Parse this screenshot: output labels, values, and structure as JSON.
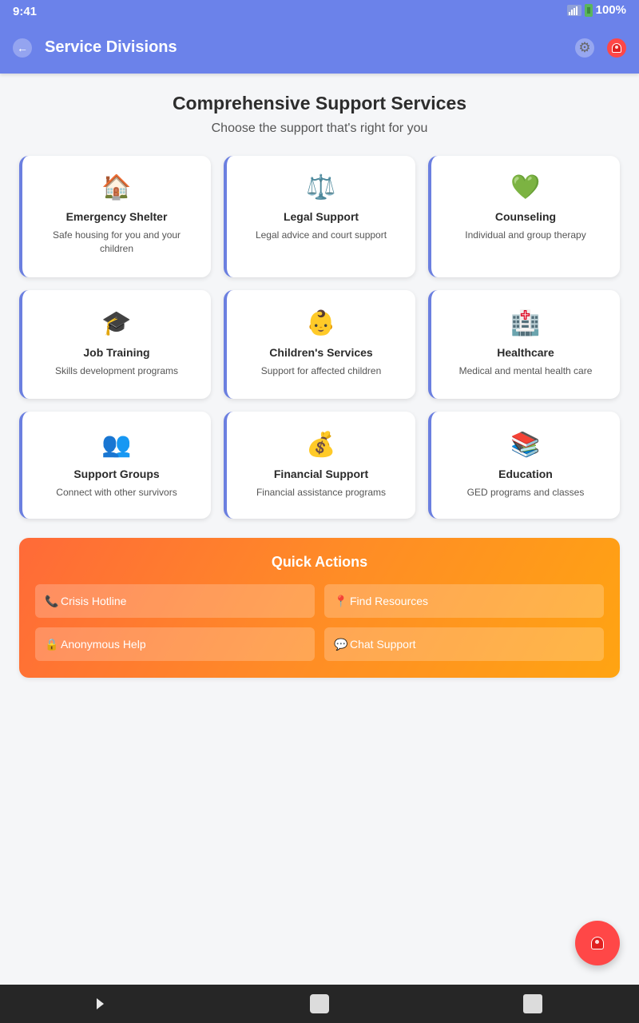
{
  "status_bar": {
    "time": "9:41",
    "battery": "100%"
  },
  "app_bar": {
    "title": "Service Divisions"
  },
  "intro": {
    "title": "Comprehensive Support Services",
    "subtitle": "Choose the support that's right for you"
  },
  "services": [
    {
      "emoji": "🏠",
      "icon": "house-icon",
      "title": "Emergency Shelter",
      "desc": "Safe housing for you and your children"
    },
    {
      "emoji": "⚖️",
      "icon": "scales-icon",
      "title": "Legal Support",
      "desc": "Legal advice and court support"
    },
    {
      "emoji": "💚",
      "icon": "green-heart-icon",
      "title": "Counseling",
      "desc": "Individual and group therapy"
    },
    {
      "emoji": "🎓",
      "icon": "graduation-cap-icon",
      "title": "Job Training",
      "desc": "Skills development programs"
    },
    {
      "emoji": "👶",
      "icon": "baby-icon",
      "title": "Children's Services",
      "desc": "Support for affected children"
    },
    {
      "emoji": "🏥",
      "icon": "hospital-icon",
      "title": "Healthcare",
      "desc": "Medical and mental health care"
    },
    {
      "emoji": "👥",
      "icon": "people-icon",
      "title": "Support Groups",
      "desc": "Connect with other survivors"
    },
    {
      "emoji": "💰",
      "icon": "money-bag-icon",
      "title": "Financial Support",
      "desc": "Financial assistance programs"
    },
    {
      "emoji": "📚",
      "icon": "books-icon",
      "title": "Education",
      "desc": "GED programs and classes"
    }
  ],
  "quick_actions": {
    "title": "Quick Actions",
    "items": [
      {
        "emoji": "📞",
        "icon": "phone-icon",
        "label": "Crisis Hotline"
      },
      {
        "emoji": "📍",
        "icon": "pin-icon",
        "label": "Find Resources"
      },
      {
        "emoji": "🔒",
        "icon": "lock-icon",
        "label": "Anonymous Help"
      },
      {
        "emoji": "💬",
        "icon": "speech-bubble-icon",
        "label": "Chat Support"
      }
    ]
  },
  "colors": {
    "header": "#6b82ea",
    "card_accent": "#6b7fe0",
    "quick_actions_gradient_start": "#ff6a38",
    "quick_actions_gradient_end": "#ffa412",
    "emergency": "#ff4747"
  }
}
